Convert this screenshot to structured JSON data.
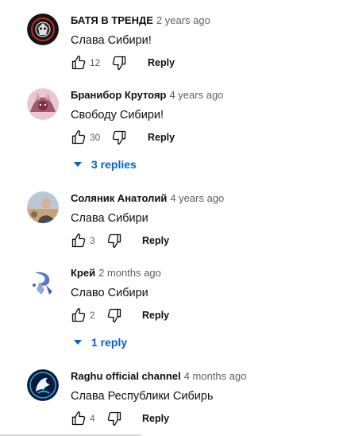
{
  "comments": [
    {
      "author": "БАТЯ В ТРЕНДЕ",
      "time": "2 years ago",
      "text": "Слава Сибири!",
      "likes": "12",
      "reply_label": "Reply",
      "avatar_colors": [
        "#1a1a1a",
        "#c62828"
      ]
    },
    {
      "author": "Бранибор Крутояр",
      "time": "4 years ago",
      "text": "Свободу Сибири!",
      "likes": "30",
      "reply_label": "Reply",
      "replies_label": "3 replies",
      "avatar_colors": [
        "#a05a6a",
        "#d9a0b0"
      ]
    },
    {
      "author": "Соляник Анатолий",
      "time": "4 years ago",
      "text": "Слава Сибири",
      "likes": "3",
      "reply_label": "Reply",
      "avatar_colors": [
        "#8aa0b0",
        "#6b5545"
      ]
    },
    {
      "author": "Крей",
      "time": "2 months ago",
      "text": "Славо Сибири",
      "likes": "2",
      "reply_label": "Reply",
      "replies_label": "1 reply",
      "avatar_colors": [
        "#ffffff",
        "#4466bb"
      ]
    },
    {
      "author": "Raghu official channel",
      "time": "4 months ago",
      "text": "Слава Республики Сибирь",
      "likes": "4",
      "reply_label": "Reply",
      "avatar_colors": [
        "#0a1a3a",
        "#2fa8e0"
      ]
    }
  ],
  "colors": {
    "link": "#065fd4",
    "meta": "#606060",
    "text": "#0f0f0f"
  }
}
